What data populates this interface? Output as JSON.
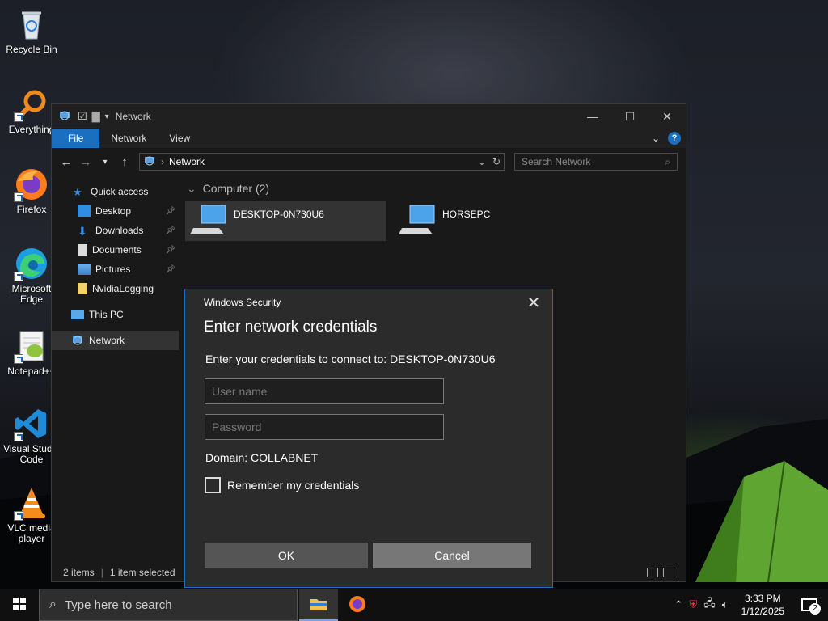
{
  "desktop": {
    "icons": [
      {
        "label": "Recycle Bin",
        "icon": "recycle-bin-icon"
      },
      {
        "label": "Everything",
        "icon": "everything-search-icon"
      },
      {
        "label": "Firefox",
        "icon": "firefox-icon"
      },
      {
        "label": "Microsoft Edge",
        "icon": "edge-icon"
      },
      {
        "label": "Notepad++",
        "icon": "notepad-plus-plus-icon"
      },
      {
        "label": "Visual Studio Code",
        "icon": "vscode-icon"
      },
      {
        "label": "VLC media player",
        "icon": "vlc-icon"
      }
    ]
  },
  "explorer": {
    "title": "Network",
    "ribbon_tabs": [
      "File",
      "Network",
      "View"
    ],
    "address_location": "Network",
    "search_placeholder": "Search Network",
    "sidebar": [
      {
        "label": "Quick access",
        "icon": "star-icon",
        "pinned": false
      },
      {
        "label": "Desktop",
        "icon": "desktop-folder-icon",
        "pinned": true
      },
      {
        "label": "Downloads",
        "icon": "downloads-icon",
        "pinned": true
      },
      {
        "label": "Documents",
        "icon": "documents-icon",
        "pinned": true
      },
      {
        "label": "Pictures",
        "icon": "pictures-icon",
        "pinned": true
      },
      {
        "label": "NvidiaLogging",
        "icon": "folder-icon",
        "pinned": false
      },
      {
        "label": "This PC",
        "icon": "this-pc-icon",
        "pinned": false
      },
      {
        "label": "Network",
        "icon": "network-icon",
        "pinned": false
      }
    ],
    "group_header": "Computer (2)",
    "computers": [
      {
        "name": "DESKTOP-0N730U6",
        "selected": true
      },
      {
        "name": "HORSEPC",
        "selected": false
      }
    ],
    "status": {
      "items": "2 items",
      "selected": "1 item selected"
    }
  },
  "dialog": {
    "app": "Windows Security",
    "title": "Enter network credentials",
    "prompt": "Enter your credentials to connect to: DESKTOP-0N730U6",
    "username_placeholder": "User name",
    "password_placeholder": "Password",
    "domain": "Domain: COLLABNET",
    "remember_label": "Remember my credentials",
    "remember_checked": false,
    "ok_label": "OK",
    "cancel_label": "Cancel"
  },
  "taskbar": {
    "search_placeholder": "Type here to search",
    "apps": [
      "file-explorer-icon",
      "firefox-icon"
    ],
    "time": "3:33 PM",
    "date": "1/12/2025",
    "notification_count": "2"
  }
}
